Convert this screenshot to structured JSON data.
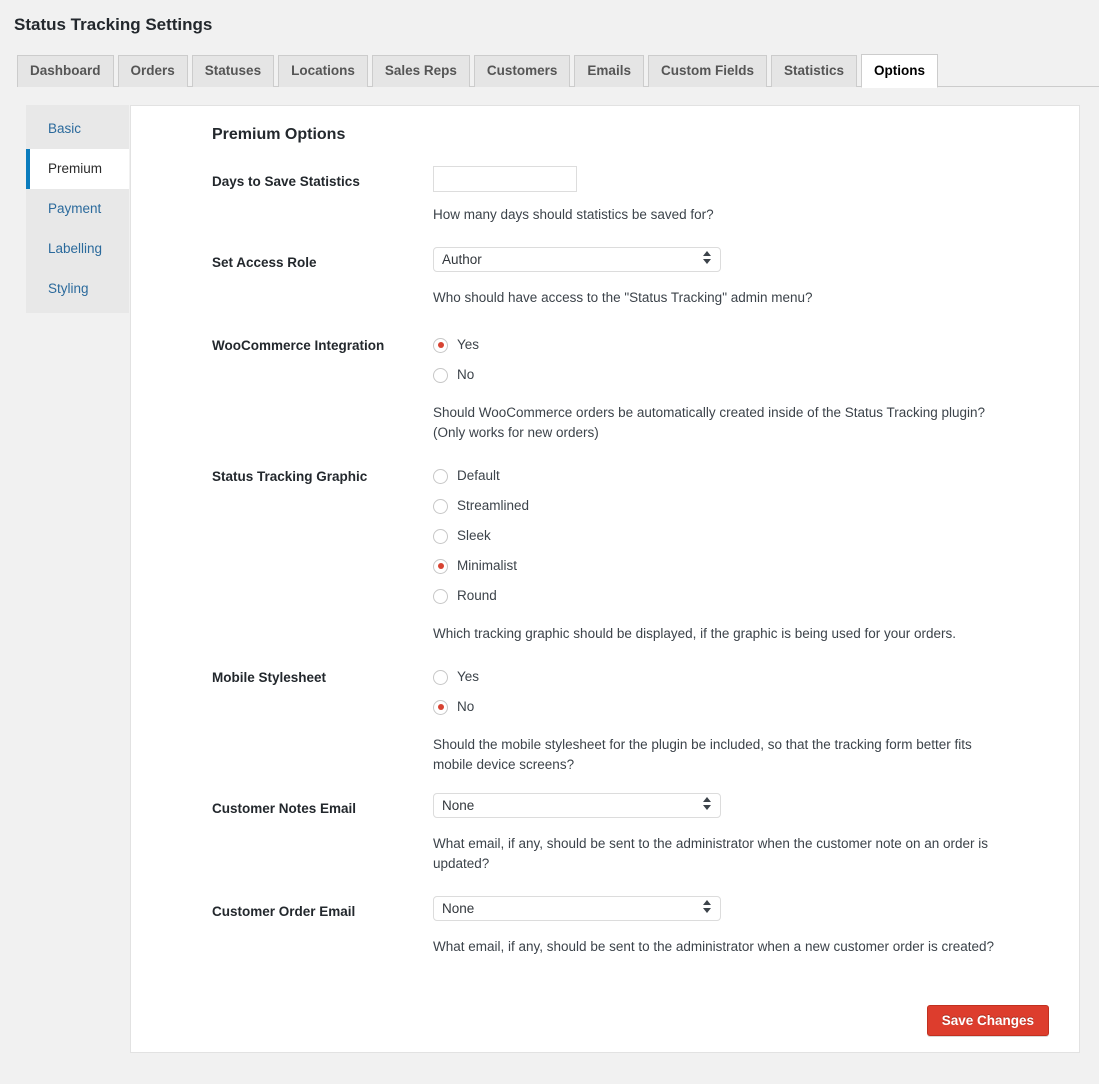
{
  "page": {
    "title": "Status Tracking Settings"
  },
  "tabs": [
    {
      "label": "Dashboard",
      "active": false
    },
    {
      "label": "Orders",
      "active": false
    },
    {
      "label": "Statuses",
      "active": false
    },
    {
      "label": "Locations",
      "active": false
    },
    {
      "label": "Sales Reps",
      "active": false
    },
    {
      "label": "Customers",
      "active": false
    },
    {
      "label": "Emails",
      "active": false
    },
    {
      "label": "Custom Fields",
      "active": false
    },
    {
      "label": "Statistics",
      "active": false
    },
    {
      "label": "Options",
      "active": true
    }
  ],
  "subnav": {
    "items": [
      {
        "label": "Basic",
        "active": false
      },
      {
        "label": "Premium",
        "active": true
      },
      {
        "label": "Payment",
        "active": false
      },
      {
        "label": "Labelling",
        "active": false
      },
      {
        "label": "Styling",
        "active": false
      }
    ]
  },
  "main": {
    "section_title": "Premium Options",
    "fields": {
      "days_to_save_statistics": {
        "label": "Days to Save Statistics",
        "value": "",
        "placeholder": "",
        "description": "How many days should statistics be saved for?"
      },
      "set_access_role": {
        "label": "Set Access Role",
        "value": "Author",
        "description": "Who should have access to the \"Status Tracking\" admin menu?"
      },
      "woocommerce_integration": {
        "label": "WooCommerce Integration",
        "options": [
          {
            "label": "Yes",
            "checked": true
          },
          {
            "label": "No",
            "checked": false
          }
        ],
        "description": "Should WooCommerce orders be automatically created inside of the Status Tracking plugin? (Only works for new orders)"
      },
      "status_tracking_graphic": {
        "label": "Status Tracking Graphic",
        "options": [
          {
            "label": "Default",
            "checked": false
          },
          {
            "label": "Streamlined",
            "checked": false
          },
          {
            "label": "Sleek",
            "checked": false
          },
          {
            "label": "Minimalist",
            "checked": true
          },
          {
            "label": "Round",
            "checked": false
          }
        ],
        "description": "Which tracking graphic should be displayed, if the graphic is being used for your orders."
      },
      "mobile_stylesheet": {
        "label": "Mobile Stylesheet",
        "options": [
          {
            "label": "Yes",
            "checked": false
          },
          {
            "label": "No",
            "checked": true
          }
        ],
        "description": "Should the mobile stylesheet for the plugin be included, so that the tracking form better fits mobile device screens?"
      },
      "customer_notes_email": {
        "label": "Customer Notes Email",
        "value": "None",
        "description": "What email, if any, should be sent to the administrator when the customer note on an order is updated?"
      },
      "customer_order_email": {
        "label": "Customer Order Email",
        "value": "None",
        "description": "What email, if any, should be sent to the administrator when a new customer order is created?"
      }
    },
    "save_label": "Save Changes"
  },
  "colors": {
    "accent_blue": "#0b7cbd",
    "radio_selected": "#d74332",
    "save_button": "#dd3d2d",
    "page_background": "#f1f1f1"
  }
}
